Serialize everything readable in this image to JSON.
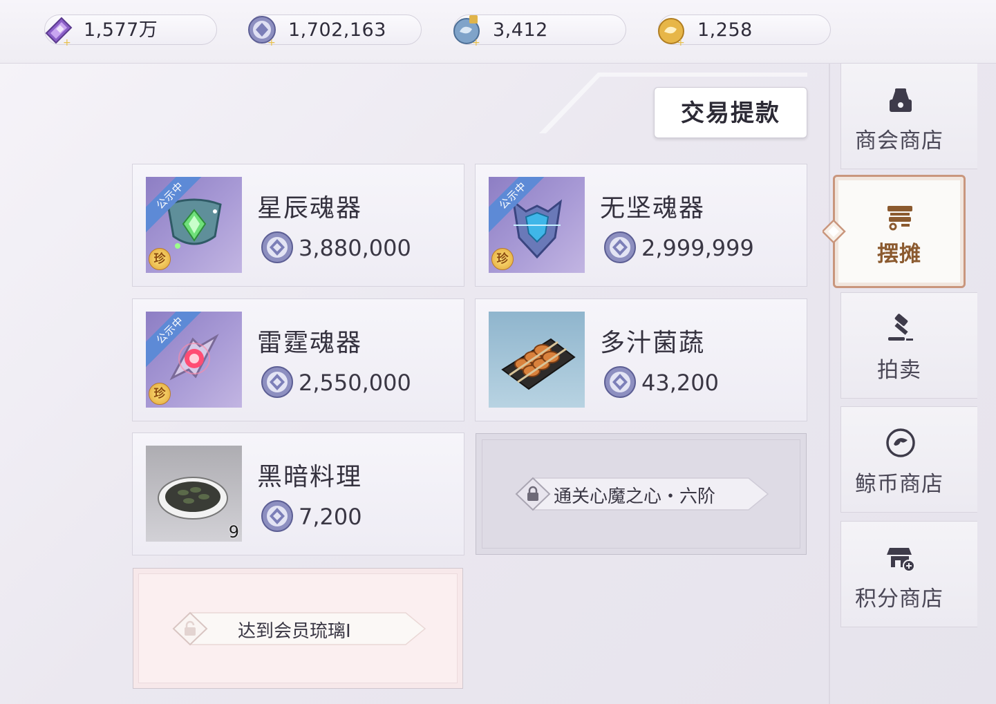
{
  "currencies": [
    {
      "icon": "crystal-ticket-icon",
      "value": "1,577万"
    },
    {
      "icon": "silver-coin-icon",
      "value": "1,702,163"
    },
    {
      "icon": "bound-whale-coin-icon",
      "value": "3,412"
    },
    {
      "icon": "whale-coin-icon",
      "value": "1,258"
    }
  ],
  "toolbar": {
    "withdraw_label": "交易提款"
  },
  "listings": [
    {
      "name": "星辰魂器",
      "price": "3,880,000",
      "ribbon": "公示中",
      "rare_badge": "珍",
      "icon": "star-soul-relic-icon"
    },
    {
      "name": "无坚魂器",
      "price": "2,999,999",
      "ribbon": "公示中",
      "rare_badge": "珍",
      "icon": "invincible-soul-relic-icon"
    },
    {
      "name": "雷霆魂器",
      "price": "2,550,000",
      "ribbon": "公示中",
      "rare_badge": "珍",
      "icon": "thunder-soul-relic-icon"
    },
    {
      "name": "多汁菌蔬",
      "price": "43,200",
      "icon": "mushroom-skewer-icon"
    },
    {
      "name": "黑暗料理",
      "price": "7,200",
      "quantity": "9",
      "icon": "dark-dish-icon"
    }
  ],
  "locked_slots": [
    {
      "text": "通关心魔之心・六阶"
    },
    {
      "text": "达到会员琉璃I"
    }
  ],
  "nav": [
    {
      "label": "商会商店",
      "icon": "guild-shop-icon"
    },
    {
      "label": "摆摊",
      "icon": "stall-icon",
      "active": true
    },
    {
      "label": "拍卖",
      "icon": "auction-gavel-icon"
    },
    {
      "label": "鲸币商店",
      "icon": "whale-coin-shop-icon"
    },
    {
      "label": "积分商店",
      "icon": "points-shop-icon"
    }
  ],
  "colors": {
    "accent": "#c9967d",
    "active_label": "#8b5a2f",
    "ribbon": "#5d8ad6",
    "rare_badge": "#e0a63a"
  }
}
